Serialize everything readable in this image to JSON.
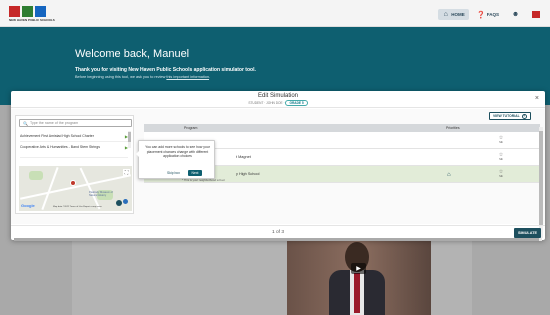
{
  "header": {
    "logo_text": "NEW HAVEN PUBLIC SCHOOLS",
    "nav": [
      {
        "label": "HOME",
        "icon": "home-icon"
      },
      {
        "label": "FAQS",
        "icon": "help-icon"
      },
      {
        "label": "",
        "icon": "user-icon"
      },
      {
        "label": "",
        "icon": "flag-icon"
      }
    ]
  },
  "hero": {
    "title": "Welcome back, Manuel",
    "subtitle": "Thank you for visiting New Haven Public Schools application simulator tool.",
    "note_prefix": "Before beginning using this tool, we ask you to review ",
    "note_link": "this important information",
    "note_suffix": "."
  },
  "modal": {
    "title": "Edit Simulation",
    "meta_prefix": "STUDENT · JOHN DOE ·",
    "grade": "GRADE 5",
    "close": "×",
    "view_tutorial": "VIEW TUTORIAL",
    "search_placeholder": "Type the name of the program",
    "programs": [
      "Achievement First Amistad High School Charter",
      "Cooperative Arts & Humanities - Band Stem Strings"
    ],
    "table": {
      "headers": [
        "Program",
        "Priorities"
      ],
      "rows": [
        {
          "name": "",
          "note": "",
          "priority": "Sib",
          "highlight": false,
          "neighborhood": false
        },
        {
          "name": "t Magnet",
          "note": "",
          "priority": "Sib",
          "highlight": false,
          "neighborhood": false
        },
        {
          "name": "y High School",
          "note": "* This is your neighborhood school",
          "priority": "Sib",
          "highlight": true,
          "neighborhood": true
        }
      ]
    },
    "tooltip": {
      "text": "You can add more schools to see how your placement chances change with different application choices",
      "skip": "Skip box",
      "next": "Next"
    },
    "map": {
      "label1": "Peabody Museum of Natural History",
      "footer": "Map data ©2022   Terms of Use   Report a map error",
      "google": "Google"
    },
    "pager": "1 of 3",
    "simulate": "SIMULATE"
  },
  "colors": {
    "hero": "#0e5f70",
    "primary": "#1d4f5e",
    "highlight_row": "#e2ecd8"
  }
}
